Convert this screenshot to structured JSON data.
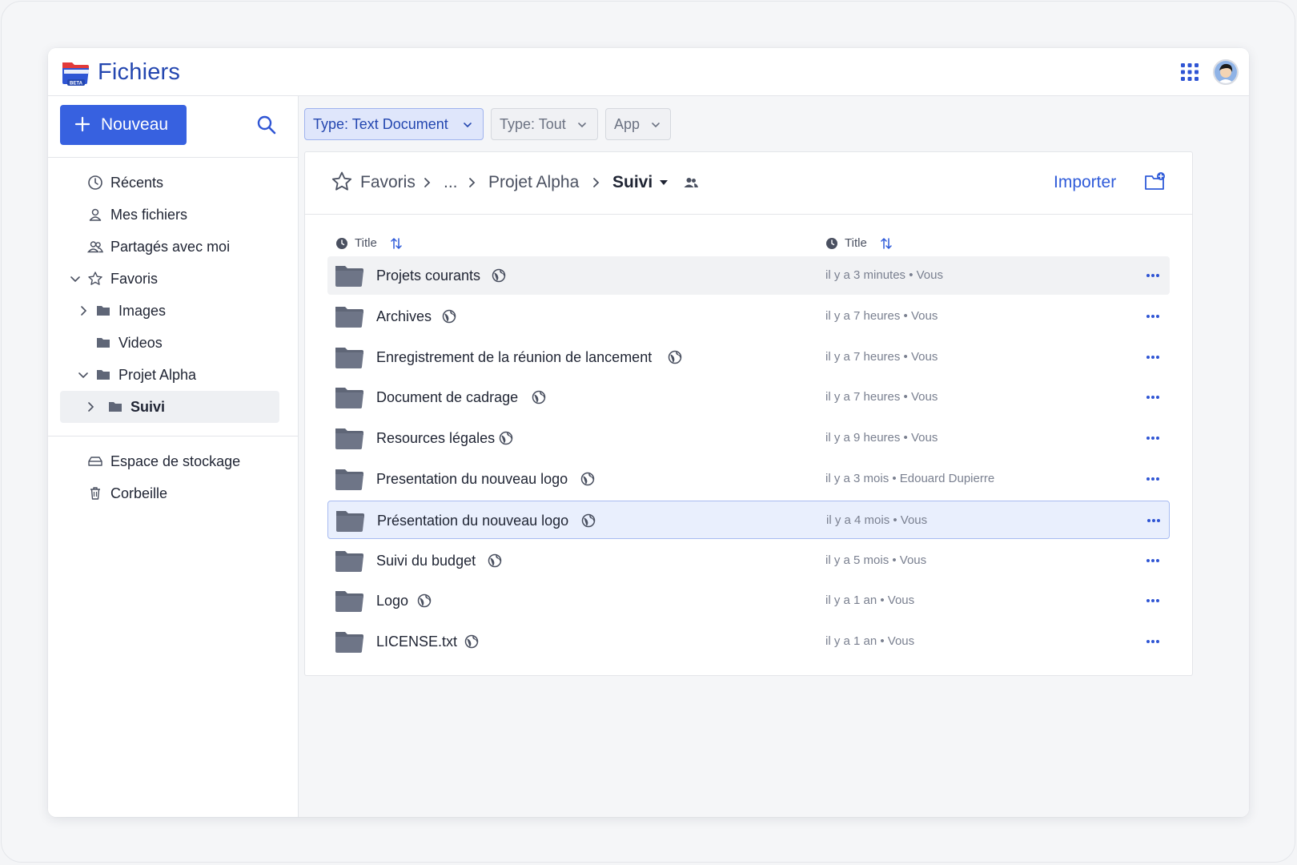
{
  "app": {
    "title": "Fichiers",
    "badge": "BETA",
    "brand_color": "#2447b0",
    "accent": "#3761e0"
  },
  "header": {
    "apps_icon": "grid-apps-icon",
    "avatar": "user-avatar"
  },
  "sidebar": {
    "new_button": "Nouveau",
    "items": [
      {
        "label": "Récents",
        "icon": "clock-icon"
      },
      {
        "label": "Mes fichiers",
        "icon": "user-icon"
      },
      {
        "label": "Partagés avec moi",
        "icon": "users-icon"
      },
      {
        "label": "Favoris",
        "icon": "star-icon",
        "expanded": true
      },
      {
        "label": "Images",
        "icon": "folder-icon",
        "collapsed": true
      },
      {
        "label": "Videos",
        "icon": "folder-icon"
      },
      {
        "label": "Projet Alpha",
        "icon": "folder-icon",
        "expanded": true
      },
      {
        "label": "Suivi",
        "icon": "folder-icon",
        "active": true
      }
    ],
    "bottom_items": [
      {
        "label": "Espace de stockage",
        "icon": "storage-icon"
      },
      {
        "label": "Corbeille",
        "icon": "trash-icon"
      }
    ]
  },
  "filters": [
    {
      "label": "Type: Text Document",
      "active": true
    },
    {
      "label": "Type: Tout",
      "active": false
    },
    {
      "label": "App",
      "active": false
    }
  ],
  "breadcrumb": {
    "items": [
      "Favoris",
      "...",
      "Projet Alpha",
      "Suivi"
    ],
    "import_label": "Importer"
  },
  "table": {
    "columns": [
      "Title",
      "Title"
    ],
    "rows": [
      {
        "name": "Projets courants",
        "meta": "il y a 3 minutes • Vous",
        "state": "hover"
      },
      {
        "name": "Archives",
        "meta": "il y a 7 heures • Vous"
      },
      {
        "name": "Enregistrement de la réunion de lancement",
        "meta": "il y a 7 heures • Vous"
      },
      {
        "name": "Document de cadrage",
        "meta": "il y a 7 heures • Vous"
      },
      {
        "name": "Resources légales",
        "meta": "il y a 9 heures • Vous"
      },
      {
        "name": "Presentation du nouveau logo",
        "meta": "il y a 3 mois • Edouard Dupierre"
      },
      {
        "name": "Présentation du nouveau logo",
        "meta": "il y a 4 mois • Vous",
        "state": "selected"
      },
      {
        "name": "Suivi du budget",
        "meta": "il y a 5 mois • Vous"
      },
      {
        "name": "Logo",
        "meta": "il y a 1 an • Vous"
      },
      {
        "name": "LICENSE.txt",
        "meta": "il y a 1 an • Vous"
      }
    ]
  }
}
